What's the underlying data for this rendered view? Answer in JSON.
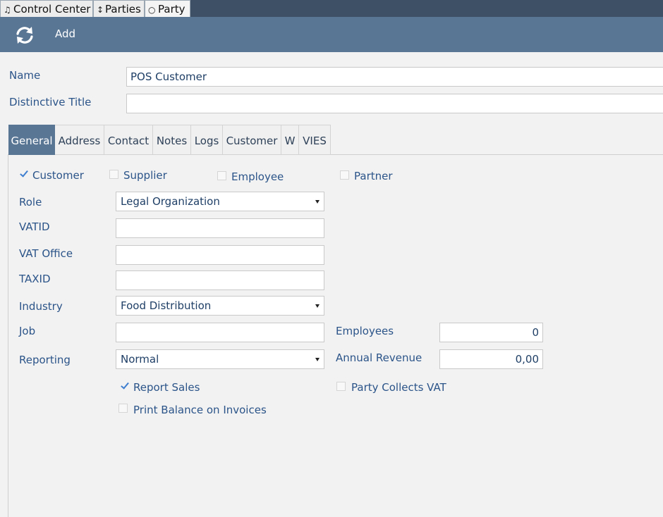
{
  "window_tabs": [
    {
      "icon": "♫",
      "label": "Control Center"
    },
    {
      "icon": "↕",
      "label": "Parties"
    },
    {
      "icon": "○",
      "label": "Party"
    }
  ],
  "toolbar": {
    "add_label": "Add"
  },
  "name": {
    "label": "Name",
    "value": "POS Customer"
  },
  "distinctive_title": {
    "label": "Distinctive Title",
    "value": ""
  },
  "tabs": [
    "General",
    "Address",
    "Contact",
    "Notes",
    "Logs",
    "Customer",
    "W",
    "VIES"
  ],
  "roles": {
    "customer": {
      "label": "Customer",
      "checked": true
    },
    "supplier": {
      "label": "Supplier",
      "checked": false
    },
    "employee": {
      "label": "Employee",
      "checked": false
    },
    "partner": {
      "label": "Partner",
      "checked": false
    }
  },
  "fields": {
    "role": {
      "label": "Role",
      "value": "Legal Organization"
    },
    "vatid": {
      "label": "VATID",
      "value": ""
    },
    "vat_office": {
      "label": "VAT Office",
      "value": ""
    },
    "taxid": {
      "label": "TAXID",
      "value": ""
    },
    "industry": {
      "label": "Industry",
      "value": "Food Distribution"
    },
    "job": {
      "label": "Job",
      "value": ""
    },
    "reporting": {
      "label": "Reporting",
      "value": "Normal"
    },
    "employees": {
      "label": "Employees",
      "value": "0"
    },
    "annual_revenue": {
      "label": "Annual Revenue",
      "value": "0,00"
    }
  },
  "options": {
    "report_sales": {
      "label": "Report Sales",
      "checked": true
    },
    "print_balance": {
      "label": "Print Balance on Invoices",
      "checked": false
    },
    "party_collects_vat": {
      "label": "Party Collects VAT",
      "checked": false
    }
  },
  "colors": {
    "header": "#5a7695",
    "tabstrip": "#3d5066",
    "label": "#2b5489",
    "check": "#3f7fd0"
  }
}
